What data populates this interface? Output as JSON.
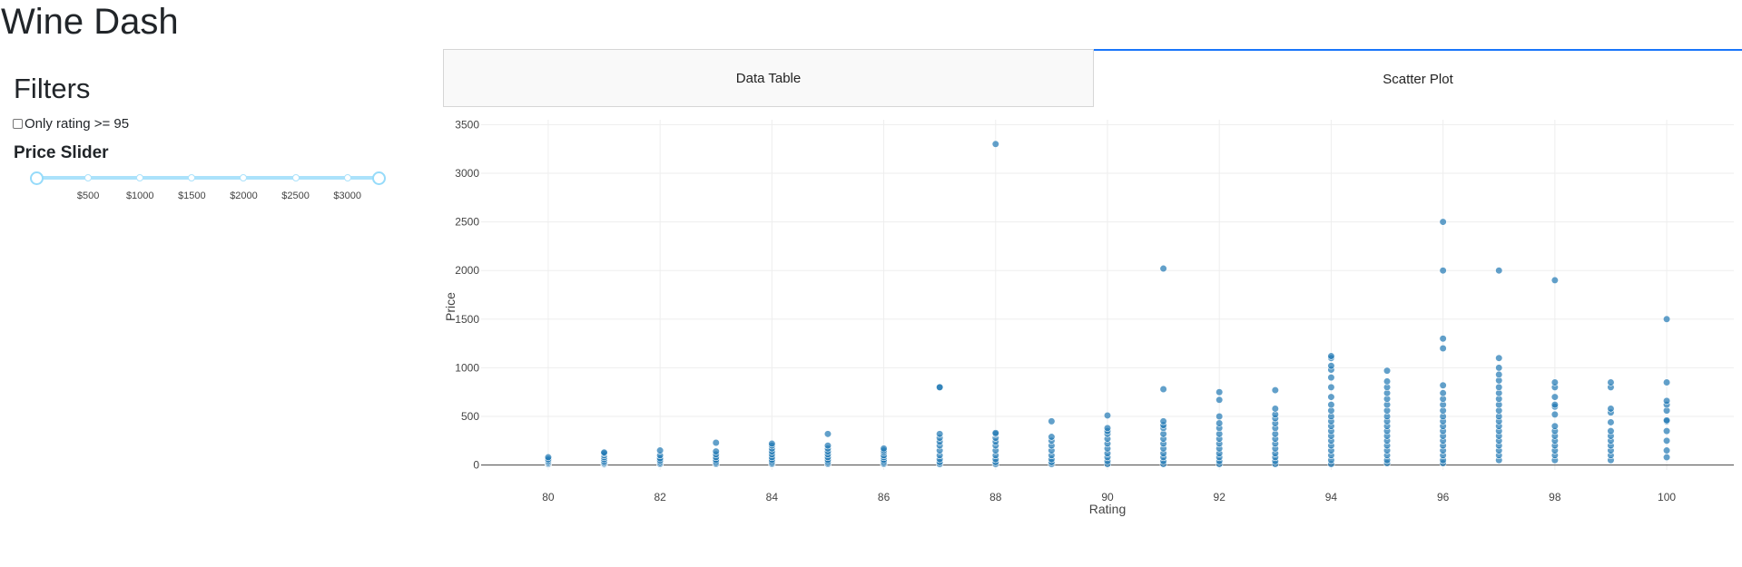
{
  "app": {
    "title": "Wine Dash"
  },
  "filters": {
    "title": "Filters",
    "checkbox_label": "Only rating >= 95",
    "checkbox_checked": false,
    "slider_title": "Price Slider",
    "slider_marks": [
      "$500",
      "$1000",
      "$1500",
      "$2000",
      "$2500",
      "$3000"
    ],
    "slider_range": [
      0,
      3300
    ],
    "slider_value": [
      0,
      3300
    ],
    "accent_color": "#abe2fb"
  },
  "tabs": {
    "items": [
      {
        "label": "Data Table",
        "selected": false
      },
      {
        "label": "Scatter Plot",
        "selected": true
      }
    ],
    "selected_color": "#1975fa"
  },
  "chart_data": {
    "type": "scatter",
    "xlabel": "Rating",
    "ylabel": "Price",
    "xlim": [
      78.8,
      101.2
    ],
    "ylim": [
      -50,
      3550
    ],
    "x_ticks": [
      80,
      82,
      84,
      86,
      88,
      90,
      92,
      94,
      96,
      98,
      100
    ],
    "y_ticks": [
      0,
      500,
      1000,
      1500,
      2000,
      2500,
      3000,
      3500
    ],
    "grid": true,
    "marker_color": "#1f77b4",
    "series": [
      {
        "points": [
          [
            80,
            10
          ],
          [
            80,
            20
          ],
          [
            80,
            30
          ],
          [
            80,
            45
          ],
          [
            80,
            60
          ],
          [
            80,
            80
          ],
          [
            81,
            8
          ],
          [
            81,
            15
          ],
          [
            81,
            25
          ],
          [
            81,
            40
          ],
          [
            81,
            60
          ],
          [
            81,
            80
          ],
          [
            81,
            100
          ],
          [
            81,
            120
          ],
          [
            81,
            130
          ],
          [
            82,
            10
          ],
          [
            82,
            20
          ],
          [
            82,
            35
          ],
          [
            82,
            50
          ],
          [
            82,
            70
          ],
          [
            82,
            100
          ],
          [
            82,
            150
          ],
          [
            83,
            10
          ],
          [
            83,
            20
          ],
          [
            83,
            35
          ],
          [
            83,
            55
          ],
          [
            83,
            80
          ],
          [
            83,
            110
          ],
          [
            83,
            140
          ],
          [
            83,
            230
          ],
          [
            84,
            10
          ],
          [
            84,
            20
          ],
          [
            84,
            35
          ],
          [
            84,
            55
          ],
          [
            84,
            80
          ],
          [
            84,
            110
          ],
          [
            84,
            140
          ],
          [
            84,
            170
          ],
          [
            84,
            200
          ],
          [
            84,
            220
          ],
          [
            85,
            10
          ],
          [
            85,
            20
          ],
          [
            85,
            35
          ],
          [
            85,
            55
          ],
          [
            85,
            80
          ],
          [
            85,
            110
          ],
          [
            85,
            140
          ],
          [
            85,
            170
          ],
          [
            85,
            200
          ],
          [
            85,
            320
          ],
          [
            86,
            10
          ],
          [
            86,
            20
          ],
          [
            86,
            35
          ],
          [
            86,
            55
          ],
          [
            86,
            80
          ],
          [
            86,
            100
          ],
          [
            86,
            130
          ],
          [
            86,
            150
          ],
          [
            86,
            170
          ],
          [
            87,
            10
          ],
          [
            87,
            30
          ],
          [
            87,
            60
          ],
          [
            87,
            100
          ],
          [
            87,
            150
          ],
          [
            87,
            200
          ],
          [
            87,
            240
          ],
          [
            87,
            280
          ],
          [
            87,
            320
          ],
          [
            87,
            800
          ],
          [
            87,
            800
          ],
          [
            88,
            10
          ],
          [
            88,
            30
          ],
          [
            88,
            60
          ],
          [
            88,
            100
          ],
          [
            88,
            150
          ],
          [
            88,
            200
          ],
          [
            88,
            240
          ],
          [
            88,
            280
          ],
          [
            88,
            320
          ],
          [
            88,
            330
          ],
          [
            88,
            3300
          ],
          [
            89,
            10
          ],
          [
            89,
            30
          ],
          [
            89,
            60
          ],
          [
            89,
            100
          ],
          [
            89,
            150
          ],
          [
            89,
            200
          ],
          [
            89,
            250
          ],
          [
            89,
            290
          ],
          [
            89,
            450
          ],
          [
            90,
            10
          ],
          [
            90,
            40
          ],
          [
            90,
            80
          ],
          [
            90,
            120
          ],
          [
            90,
            170
          ],
          [
            90,
            220
          ],
          [
            90,
            270
          ],
          [
            90,
            320
          ],
          [
            90,
            350
          ],
          [
            90,
            380
          ],
          [
            90,
            510
          ],
          [
            91,
            10
          ],
          [
            91,
            40
          ],
          [
            91,
            80
          ],
          [
            91,
            120
          ],
          [
            91,
            170
          ],
          [
            91,
            220
          ],
          [
            91,
            270
          ],
          [
            91,
            320
          ],
          [
            91,
            380
          ],
          [
            91,
            410
          ],
          [
            91,
            450
          ],
          [
            91,
            780
          ],
          [
            91,
            2020
          ],
          [
            92,
            10
          ],
          [
            92,
            40
          ],
          [
            92,
            80
          ],
          [
            92,
            120
          ],
          [
            92,
            170
          ],
          [
            92,
            220
          ],
          [
            92,
            270
          ],
          [
            92,
            320
          ],
          [
            92,
            380
          ],
          [
            92,
            430
          ],
          [
            92,
            500
          ],
          [
            92,
            670
          ],
          [
            92,
            750
          ],
          [
            93,
            10
          ],
          [
            93,
            40
          ],
          [
            93,
            80
          ],
          [
            93,
            120
          ],
          [
            93,
            170
          ],
          [
            93,
            220
          ],
          [
            93,
            270
          ],
          [
            93,
            320
          ],
          [
            93,
            380
          ],
          [
            93,
            430
          ],
          [
            93,
            480
          ],
          [
            93,
            520
          ],
          [
            93,
            580
          ],
          [
            93,
            770
          ],
          [
            94,
            10
          ],
          [
            94,
            50
          ],
          [
            94,
            100
          ],
          [
            94,
            150
          ],
          [
            94,
            200
          ],
          [
            94,
            250
          ],
          [
            94,
            300
          ],
          [
            94,
            350
          ],
          [
            94,
            400
          ],
          [
            94,
            450
          ],
          [
            94,
            500
          ],
          [
            94,
            560
          ],
          [
            94,
            620
          ],
          [
            94,
            700
          ],
          [
            94,
            800
          ],
          [
            94,
            900
          ],
          [
            94,
            980
          ],
          [
            94,
            1020
          ],
          [
            94,
            1100
          ],
          [
            94,
            1120
          ],
          [
            95,
            20
          ],
          [
            95,
            50
          ],
          [
            95,
            100
          ],
          [
            95,
            150
          ],
          [
            95,
            200
          ],
          [
            95,
            250
          ],
          [
            95,
            300
          ],
          [
            95,
            350
          ],
          [
            95,
            400
          ],
          [
            95,
            450
          ],
          [
            95,
            500
          ],
          [
            95,
            560
          ],
          [
            95,
            620
          ],
          [
            95,
            680
          ],
          [
            95,
            740
          ],
          [
            95,
            800
          ],
          [
            95,
            860
          ],
          [
            95,
            970
          ],
          [
            96,
            20
          ],
          [
            96,
            50
          ],
          [
            96,
            100
          ],
          [
            96,
            150
          ],
          [
            96,
            200
          ],
          [
            96,
            250
          ],
          [
            96,
            300
          ],
          [
            96,
            350
          ],
          [
            96,
            400
          ],
          [
            96,
            450
          ],
          [
            96,
            500
          ],
          [
            96,
            560
          ],
          [
            96,
            620
          ],
          [
            96,
            680
          ],
          [
            96,
            740
          ],
          [
            96,
            820
          ],
          [
            96,
            1200
          ],
          [
            96,
            1300
          ],
          [
            96,
            2000
          ],
          [
            96,
            2500
          ],
          [
            97,
            50
          ],
          [
            97,
            100
          ],
          [
            97,
            150
          ],
          [
            97,
            200
          ],
          [
            97,
            250
          ],
          [
            97,
            300
          ],
          [
            97,
            350
          ],
          [
            97,
            400
          ],
          [
            97,
            450
          ],
          [
            97,
            500
          ],
          [
            97,
            560
          ],
          [
            97,
            620
          ],
          [
            97,
            680
          ],
          [
            97,
            740
          ],
          [
            97,
            800
          ],
          [
            97,
            870
          ],
          [
            97,
            930
          ],
          [
            97,
            1000
          ],
          [
            97,
            1100
          ],
          [
            97,
            2000
          ],
          [
            98,
            50
          ],
          [
            98,
            100
          ],
          [
            98,
            150
          ],
          [
            98,
            200
          ],
          [
            98,
            250
          ],
          [
            98,
            300
          ],
          [
            98,
            350
          ],
          [
            98,
            400
          ],
          [
            98,
            520
          ],
          [
            98,
            600
          ],
          [
            98,
            620
          ],
          [
            98,
            700
          ],
          [
            98,
            800
          ],
          [
            98,
            850
          ],
          [
            98,
            1900
          ],
          [
            99,
            50
          ],
          [
            99,
            100
          ],
          [
            99,
            150
          ],
          [
            99,
            200
          ],
          [
            99,
            250
          ],
          [
            99,
            300
          ],
          [
            99,
            350
          ],
          [
            99,
            440
          ],
          [
            99,
            540
          ],
          [
            99,
            580
          ],
          [
            99,
            800
          ],
          [
            99,
            850
          ],
          [
            100,
            80
          ],
          [
            100,
            150
          ],
          [
            100,
            250
          ],
          [
            100,
            350
          ],
          [
            100,
            450
          ],
          [
            100,
            460
          ],
          [
            100,
            560
          ],
          [
            100,
            620
          ],
          [
            100,
            660
          ],
          [
            100,
            850
          ],
          [
            100,
            1500
          ]
        ]
      }
    ]
  }
}
